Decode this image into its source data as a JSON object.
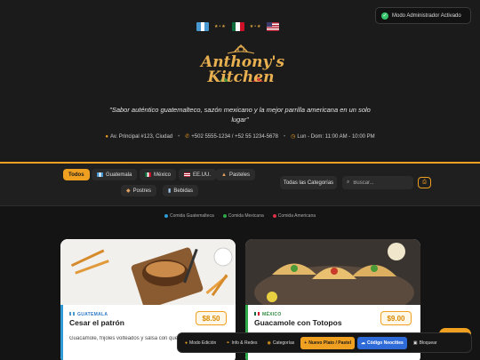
{
  "header": {
    "admin_badge": "Modo Administrador Activado",
    "flags": [
      "guatemala-flag",
      "mexico-flag",
      "usa-flag"
    ],
    "logo_title_line1": "Anthony's",
    "logo_title_line2": "Kitchen",
    "tagline": "\"Sabor auténtico guatemalteco, sazón mexicano y la mejor parrilla americana en un solo lugar\"",
    "address": "Av. Principal #123, Ciudad",
    "phone": "+502 5555-1234 / +52 55 1234-5678",
    "hours": "Lun - Dom: 11:00 AM - 10:00 PM"
  },
  "filters": {
    "chips": [
      {
        "label": "Todos",
        "icon": ""
      },
      {
        "label": "Guatemala",
        "icon": "guatemala-flag"
      },
      {
        "label": "México",
        "icon": "mexico-flag"
      },
      {
        "label": "EE.UU.",
        "icon": "usa-flag"
      },
      {
        "label": "Pasteles",
        "icon": "cake-icon"
      },
      {
        "label": "Postres",
        "icon": "dessert-icon"
      },
      {
        "label": "Bebidas",
        "icon": "cup-icon"
      }
    ],
    "category_select": "Todas las Categorías",
    "search_placeholder": "Buscar..."
  },
  "legend": [
    {
      "label": "Comida Guatemalteca",
      "color": "#2e9bd6"
    },
    {
      "label": "Comida Mexicana",
      "color": "#2ea84a"
    },
    {
      "label": "Comida Americana",
      "color": "#d9304a"
    }
  ],
  "cards": [
    {
      "country": "GUATEMALA",
      "dish": "Cesar el patrón",
      "price": "$8.50",
      "description": "Guacamole, frijoles volteados y salsa con queso",
      "accent": "#2e9bd6",
      "country_color": "#2e78c8"
    },
    {
      "country": "MÉXICO",
      "dish": "Guacamole con Totopos",
      "price": "$9.00",
      "description": "",
      "accent": "#2ea84a",
      "country_color": "#2e8a3e"
    }
  ],
  "toolbar": {
    "items": [
      {
        "label": "Modo Edición",
        "icon": "user-edit-icon"
      },
      {
        "label": "Info & Redes",
        "icon": "link-icon"
      },
      {
        "label": "Categorías",
        "icon": "tag-icon"
      },
      {
        "label": "Nuevo Plato / Pastel",
        "icon": "plus-icon"
      },
      {
        "label": "Código Neocities",
        "icon": "cloud-icon"
      },
      {
        "label": "Bloquear",
        "icon": "lock-icon"
      }
    ]
  }
}
